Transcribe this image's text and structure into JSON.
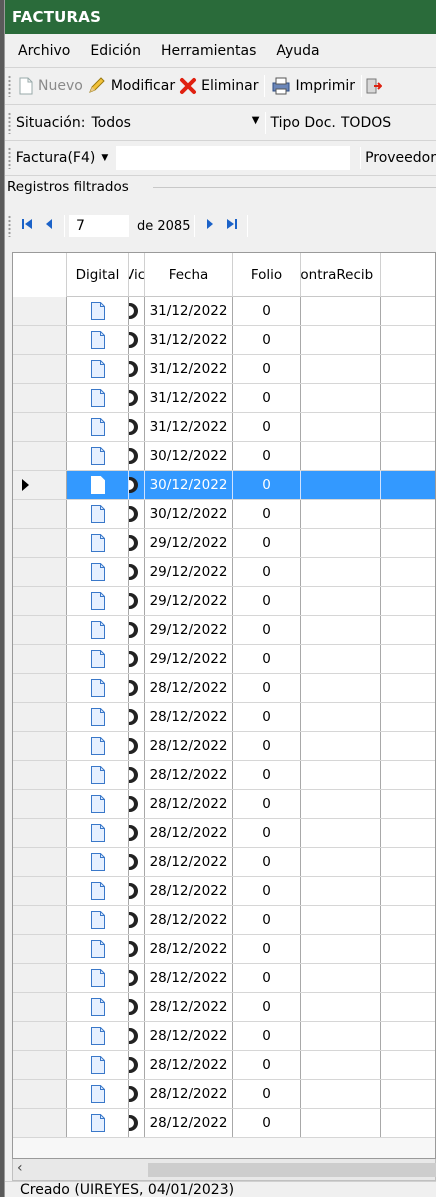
{
  "window": {
    "title": "FACTURAS"
  },
  "menu": [
    "Archivo",
    "Edición",
    "Herramientas",
    "Ayuda"
  ],
  "toolbar": {
    "nuevo": "Nuevo",
    "modificar": "Modificar",
    "eliminar": "Eliminar",
    "imprimir": "Imprimir"
  },
  "filters": {
    "situacion_label": "Situación:",
    "situacion_value": "Todos",
    "tipo_doc_label": "Tipo Doc.",
    "tipo_doc_value": "TODOS",
    "factura_label": "Factura(F4)",
    "proveedor_label": "Proveedor"
  },
  "section": {
    "title": "Registros filtrados"
  },
  "navigator": {
    "position": "7",
    "of_label": "de 2085"
  },
  "grid": {
    "columns": {
      "digital": "Digital",
      "col2": "Vic",
      "fecha": "Fecha",
      "folio": "Folio",
      "contra": "ContraRecib"
    },
    "selected_index": 6,
    "rows": [
      {
        "fecha": "31/12/2022",
        "folio": "0"
      },
      {
        "fecha": "31/12/2022",
        "folio": "0"
      },
      {
        "fecha": "31/12/2022",
        "folio": "0"
      },
      {
        "fecha": "31/12/2022",
        "folio": "0"
      },
      {
        "fecha": "31/12/2022",
        "folio": "0"
      },
      {
        "fecha": "30/12/2022",
        "folio": "0"
      },
      {
        "fecha": "30/12/2022",
        "folio": "0"
      },
      {
        "fecha": "30/12/2022",
        "folio": "0"
      },
      {
        "fecha": "29/12/2022",
        "folio": "0"
      },
      {
        "fecha": "29/12/2022",
        "folio": "0"
      },
      {
        "fecha": "29/12/2022",
        "folio": "0"
      },
      {
        "fecha": "29/12/2022",
        "folio": "0"
      },
      {
        "fecha": "29/12/2022",
        "folio": "0"
      },
      {
        "fecha": "28/12/2022",
        "folio": "0"
      },
      {
        "fecha": "28/12/2022",
        "folio": "0"
      },
      {
        "fecha": "28/12/2022",
        "folio": "0"
      },
      {
        "fecha": "28/12/2022",
        "folio": "0"
      },
      {
        "fecha": "28/12/2022",
        "folio": "0"
      },
      {
        "fecha": "28/12/2022",
        "folio": "0"
      },
      {
        "fecha": "28/12/2022",
        "folio": "0"
      },
      {
        "fecha": "28/12/2022",
        "folio": "0"
      },
      {
        "fecha": "28/12/2022",
        "folio": "0"
      },
      {
        "fecha": "28/12/2022",
        "folio": "0"
      },
      {
        "fecha": "28/12/2022",
        "folio": "0"
      },
      {
        "fecha": "28/12/2022",
        "folio": "0"
      },
      {
        "fecha": "28/12/2022",
        "folio": "0"
      },
      {
        "fecha": "28/12/2022",
        "folio": "0"
      },
      {
        "fecha": "28/12/2022",
        "folio": "0"
      },
      {
        "fecha": "28/12/2022",
        "folio": "0"
      }
    ]
  },
  "status": {
    "text": "Creado (UIREYES, 04/01/2023)"
  },
  "colors": {
    "titlebar": "#2a6b3a",
    "selection": "#3399ff",
    "nav_icon": "#1b62c8"
  }
}
